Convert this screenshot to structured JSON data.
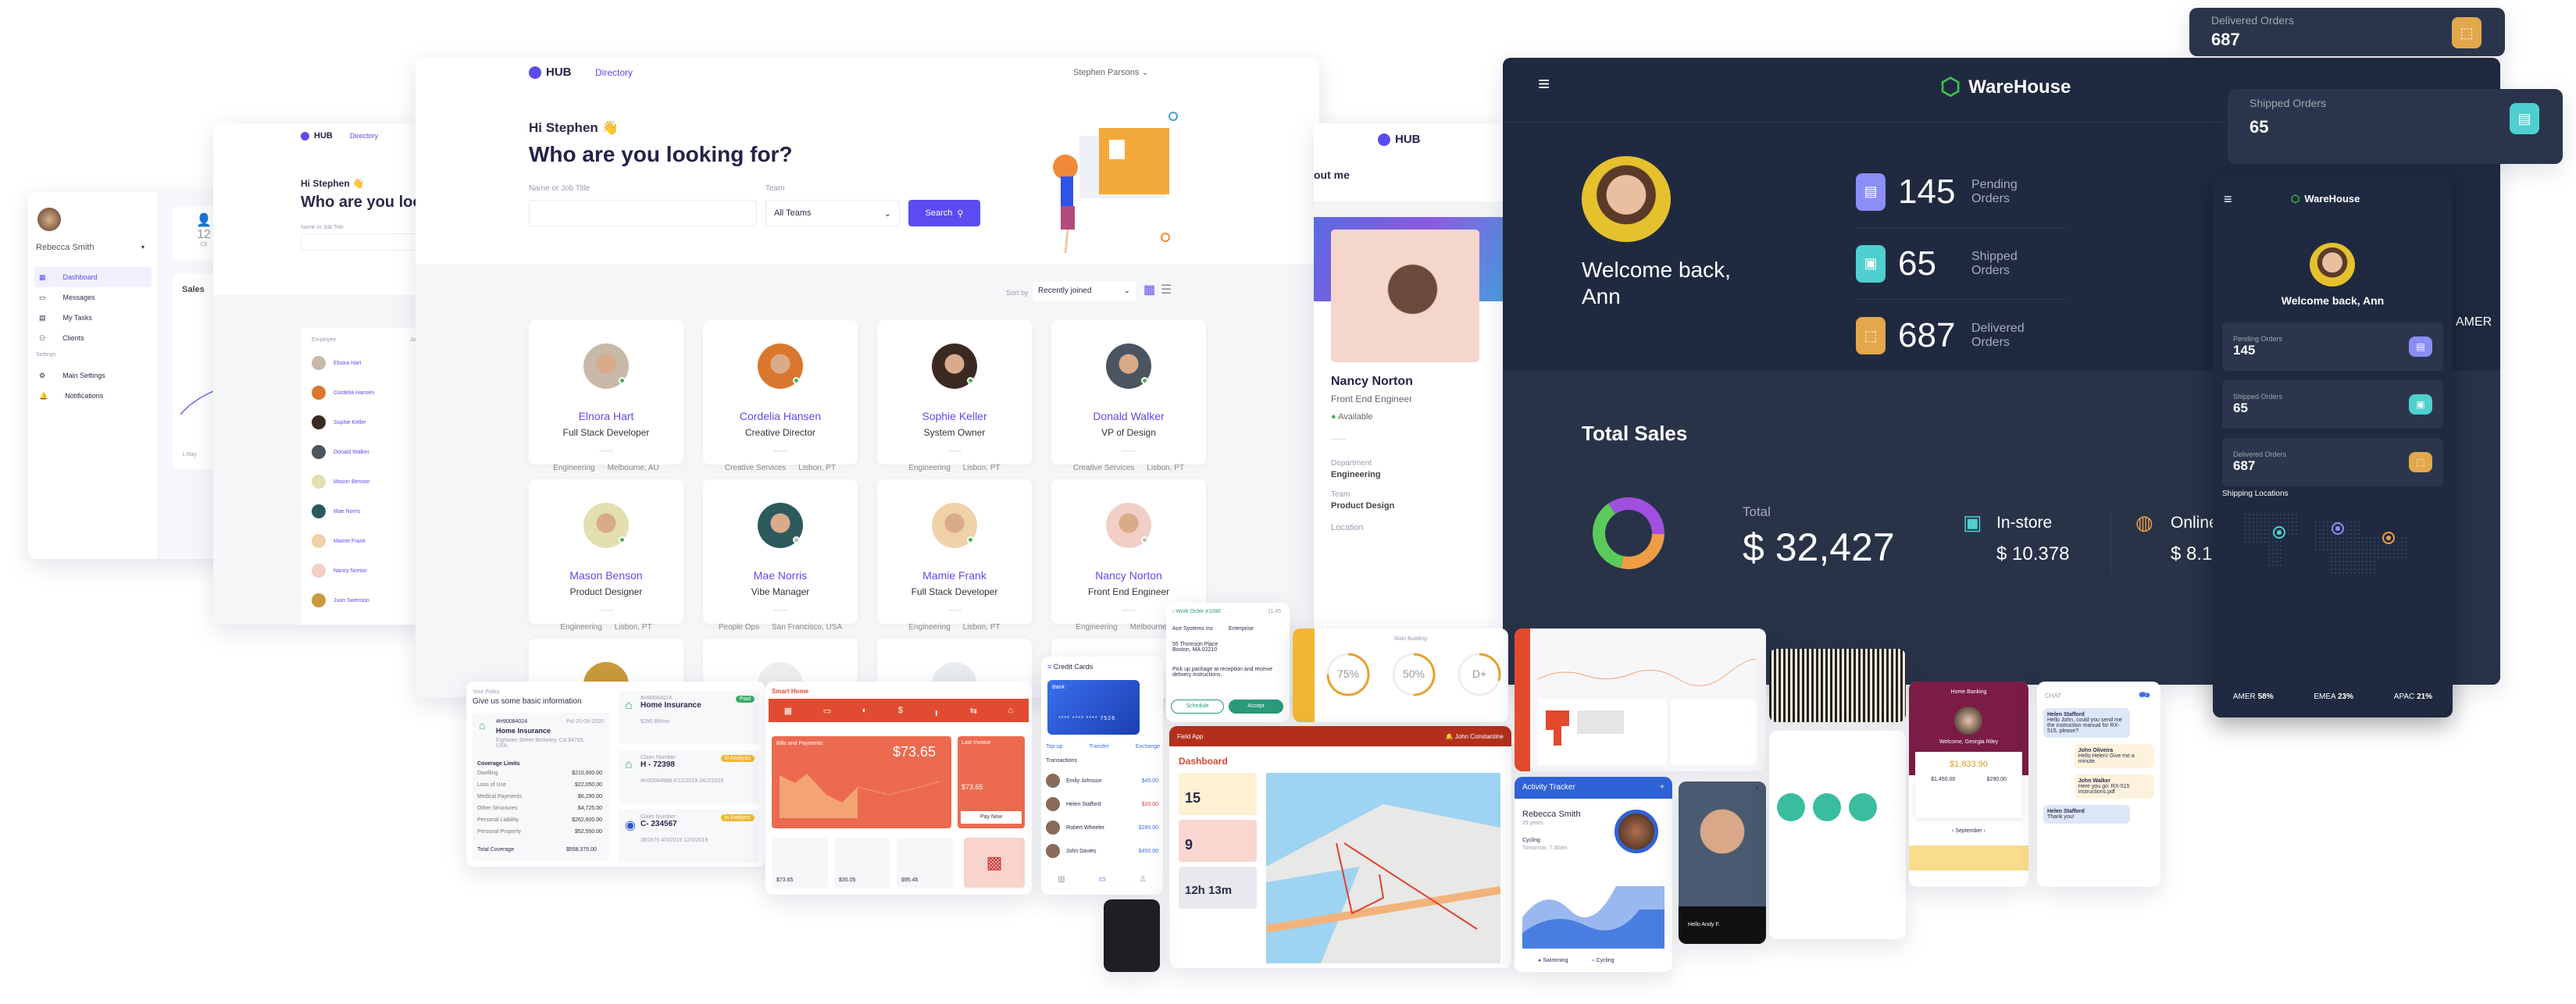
{
  "colors": {
    "brand_purple": "#5a4cf0",
    "warehouse_bg": "#1f2a40",
    "pending": "#8b8ff5",
    "shipped": "#4fcfcf",
    "delivered": "#e2a84b",
    "smart_home_red": "#e14b32",
    "field_app_red": "#b22f1c",
    "activity_blue": "#2f62d6",
    "banking_maroon": "#7a1c45"
  },
  "left_dashboard": {
    "user": "Rebecca Smith",
    "nav": [
      {
        "label": "Dashboard",
        "icon": "dashboard-icon"
      },
      {
        "label": "Messages",
        "icon": "message-icon"
      },
      {
        "label": "My Tasks",
        "icon": "tasks-icon"
      },
      {
        "label": "Clients",
        "icon": "clients-icon"
      }
    ],
    "settings_heading": "Settings",
    "settings": [
      {
        "label": "Main Settings",
        "icon": "gear-icon"
      },
      {
        "label": "Notifications",
        "icon": "bell-icon"
      }
    ],
    "stat_value": "12",
    "stat_label": "Cli",
    "sales_title": "Sales",
    "axis_label": "1 May"
  },
  "hub_list": {
    "logo": "HUB",
    "nav": "Directory",
    "greeting": "Hi Stephen 👋",
    "title": "Who are you looking for?",
    "field_label": "Name or Job Title",
    "col_employee": "Employee",
    "col_job": "Job",
    "rows": [
      {
        "name": "Elnora Hart",
        "job": "Fu"
      },
      {
        "name": "Cordelia Hansen",
        "job": "Cr"
      },
      {
        "name": "Sophie Keller",
        "job": "Sy"
      },
      {
        "name": "Donald Walker",
        "job": "VP"
      },
      {
        "name": "Mason Benson",
        "job": "Pr"
      },
      {
        "name": "Mae Norris",
        "job": "Vi"
      },
      {
        "name": "Mamie Frank",
        "job": "Fu"
      },
      {
        "name": "Nancy Norton",
        "job": "Fr"
      },
      {
        "name": "Juan Swenson",
        "job": "Fu"
      }
    ]
  },
  "hub": {
    "logo": "HUB",
    "nav": "Directory",
    "user": "Stephen Parsons",
    "greeting": "Hi Stephen 👋",
    "title": "Who are you looking for?",
    "name_label": "Name or Job Title",
    "name_value": "",
    "team_label": "Team",
    "team_value": "All Teams",
    "search_label": "Search",
    "sort_label": "Sort by",
    "sort_value": "Recently joined",
    "people": [
      {
        "name": "Elnora Hart",
        "title": "Full Stack Developer",
        "dept": "Engineering",
        "loc": "Melbourne, AU",
        "online": true,
        "color": "#c9b9a8"
      },
      {
        "name": "Cordelia Hansen",
        "title": "Creative Director",
        "dept": "Creative Services",
        "loc": "Lisbon, PT",
        "online": true,
        "color": "#d9772e"
      },
      {
        "name": "Sophie Keller",
        "title": "System Owner",
        "dept": "Engineering",
        "loc": "Lisbon, PT",
        "online": true,
        "color": "#3a2a22"
      },
      {
        "name": "Donald Walker",
        "title": "VP of Design",
        "dept": "Creative Services",
        "loc": "Lisbon, PT",
        "online": true,
        "color": "#4a5560"
      },
      {
        "name": "Mason Benson",
        "title": "Product Designer",
        "dept": "Engineering",
        "loc": "Lisbon, PT",
        "online": true,
        "color": "#e3dfb0"
      },
      {
        "name": "Mae Norris",
        "title": "Vibe Manager",
        "dept": "People Ops",
        "loc": "San Francisco, USA",
        "online": false,
        "color": "#2c5a5c"
      },
      {
        "name": "Mamie Frank",
        "title": "Full Stack Developer",
        "dept": "Engineering",
        "loc": "Lisbon, PT",
        "online": true,
        "color": "#f0d2a8"
      },
      {
        "name": "Nancy Norton",
        "title": "Front End Engineer",
        "dept": "Engineering",
        "loc": "Melbourne, AU",
        "online": false,
        "color": "#f2cfc6"
      }
    ]
  },
  "profile": {
    "logo": "HUB",
    "heading": "out me",
    "name": "Nancy Norton",
    "title": "Front End Engineer",
    "status": "Available",
    "dept_label": "Department",
    "dept": "Engineering",
    "team_label": "Team",
    "team": "Product Design",
    "loc_label": "Location"
  },
  "warehouse": {
    "brand": "WareHouse",
    "welcome": "Welcome back, Ann",
    "stats": [
      {
        "value": "145",
        "label": "Pending Orders",
        "icon": "clipboard-icon",
        "color": "#8b8ff5"
      },
      {
        "value": "65",
        "label": "Shipped Orders",
        "icon": "box-icon",
        "color": "#4fcfcf"
      },
      {
        "value": "687",
        "label": "Delivered Orders",
        "icon": "delivery-icon",
        "color": "#e2a84b"
      }
    ],
    "sales_title": "Total Sales",
    "total_label": "Total",
    "total_value": "$ 32,427",
    "instore_label": "In-store",
    "instore_value": "$ 10.378",
    "online_label": "Online",
    "online_value": "$ 8.10",
    "donut": [
      {
        "label": "purple",
        "value": 35,
        "color": "#a14fe0"
      },
      {
        "label": "orange",
        "value": 28,
        "color": "#ef9d45"
      },
      {
        "label": "green",
        "value": 37,
        "color": "#5acb5a"
      }
    ],
    "region_peek": "AMER",
    "float_delivered": {
      "label": "Delivered Orders",
      "value": "687"
    },
    "float_shipped": {
      "label": "Shipped Orders",
      "value": "65"
    },
    "mobile": {
      "locations_title": "Shipping Locations",
      "regions": [
        {
          "name": "AMER",
          "pct": "58%"
        },
        {
          "name": "EMEA",
          "pct": "23%"
        },
        {
          "name": "APAC",
          "pct": "21%"
        }
      ]
    }
  },
  "insurance": {
    "step": "Your Policy",
    "title": "Give us some basic information",
    "policy_no": "#H90084024",
    "date": "Pol 20-09-2020",
    "policy_name": "Home Insurance",
    "address": "Eighteen Street Berkeley, CA 94705, USA",
    "limits_title": "Coverage Limits",
    "limits": [
      {
        "k": "Dwelling",
        "v": "$210,000.00"
      },
      {
        "k": "Loss of Use",
        "v": "$22,050.00"
      },
      {
        "k": "Medical Payments",
        "v": "$6,290.00"
      },
      {
        "k": "Other Structures",
        "v": "$4,725.00"
      },
      {
        "k": "Personal Liability",
        "v": "$262,600.00"
      },
      {
        "k": "Personal Property",
        "v": "$52,550.00"
      }
    ],
    "total_k": "Total Coverage",
    "total_v": "$558,375.00",
    "side": [
      {
        "id": "#H90084024",
        "title": "Home Insurance",
        "badge": "Paid",
        "extra": "$290.89/mo"
      },
      {
        "id": "Claim Number",
        "title": "H - 72398",
        "badge": "In Analysis",
        "extra": "#H90084598  4/12/2019  24/2/2019"
      },
      {
        "id": "Claim Number",
        "title": "C- 234567",
        "badge": "In Analysis",
        "extra": "3E0979  4/3/2019  12/3/2019"
      }
    ]
  },
  "smart_home": {
    "brand": "Smart Home",
    "bills_title": "Bills and Payments",
    "amount": "$73.65",
    "last_invoice": "Last Invoice",
    "last_amount": "$73.65",
    "pay_label": "Pay Now",
    "tiles": [
      "$73.65",
      "$35.05",
      "$95.45"
    ]
  },
  "credit_cards": {
    "title": "Credit Cards",
    "bank": "Bank",
    "card_no": "**** **** **** 7526",
    "actions": [
      "Top-up",
      "Transfer",
      "Exchange"
    ],
    "transactions_title": "Transactions",
    "tx": [
      {
        "name": "Emily Johnson",
        "amt": "$45.00",
        "color": "#3b6ff0"
      },
      {
        "name": "Helen Stafford",
        "amt": "$20.00",
        "color": "#e04040"
      },
      {
        "name": "Robert Wheeler",
        "amt": "$280.00",
        "color": "#3b6ff0"
      },
      {
        "name": "John Davies",
        "amt": "$450.00",
        "color": "#3b6ff0"
      }
    ]
  },
  "work_order": {
    "title": "Work Order #1090",
    "time": "11:45",
    "customer": "Ace Systems Inc",
    "type": "Enterprise",
    "address": "55 Thomson Place Boston, MA 02210",
    "note": "Pick up package at reception and receive delivery instructions.",
    "schedule": "Schedule",
    "accept": "Accept"
  },
  "main_building": {
    "title": "Main Building",
    "gauges": [
      {
        "value": "75%",
        "pct": 75
      },
      {
        "value": "50%",
        "pct": 50
      },
      {
        "value": "D+",
        "pct": 30
      }
    ]
  },
  "field_app": {
    "brand": "Field App",
    "user": "John Constantine",
    "title": "Dashboard",
    "tiles": [
      {
        "value": "15",
        "bg": "#fdf1d2"
      },
      {
        "value": "9",
        "bg": "#f9d6d0"
      },
      {
        "value": "12h 13m",
        "bg": "#e7e9ee"
      }
    ]
  },
  "activity": {
    "title": "Activity Tracker",
    "name": "Rebecca Smith",
    "age": "29 years",
    "activity": "Cycling",
    "when": "Tomorrow, 7:30am",
    "legend": [
      "Swimming",
      "Cycling"
    ]
  },
  "face_id": {
    "greeting": "Hello Andy F."
  },
  "banking": {
    "title": "Home Banking",
    "welcome": "Welcome, Georgia Riley",
    "balance": "$1,833.90",
    "expenses": "$1,450.00",
    "deposits": "$290.00",
    "month": "September"
  },
  "chat": {
    "title": "CHAT",
    "messages": [
      {
        "from": "Helen Stafford",
        "text": "Hello John, could you send me the instruction manual for RX-515, please?",
        "side": "left"
      },
      {
        "from": "John Oliveira",
        "text": "Hello Helen! Give me a minute.",
        "side": "right"
      },
      {
        "from": "John Walker",
        "text": "Here you go: RX-515 instructions.pdf",
        "side": "right"
      },
      {
        "from": "Helen Stafford",
        "text": "Thank you!",
        "side": "left"
      }
    ]
  }
}
